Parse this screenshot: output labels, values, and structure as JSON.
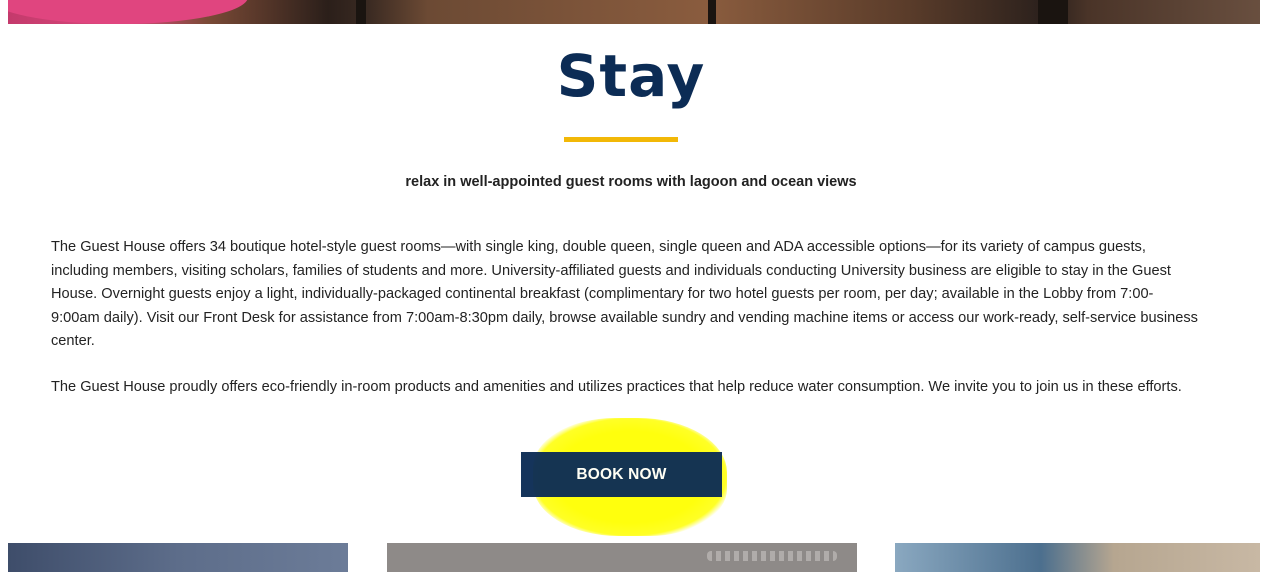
{
  "section": {
    "title": "Stay",
    "subtitle": "relax in well-appointed guest rooms with lagoon and ocean views",
    "paragraphs": [
      "The Guest House offers 34 boutique hotel-style guest rooms—with single king, double queen, single queen and ADA accessible options—for its variety of campus guests, including members, visiting scholars, families of students and more. University-affiliated guests and individuals conducting University business are eligible to stay in the Guest House. Overnight guests enjoy a light, individually-packaged continental breakfast (complimentary for two hotel guests per room, per day; available in the Lobby from 7:00-9:00am daily). Visit our Front Desk for assistance from 7:00am-8:30pm daily, browse available sundry and vending machine items or access our work-ready, self-service business center.",
      "The Guest House proudly offers eco-friendly in-room products and amenities and utilizes practices that help reduce water consumption. We invite you to join us in these efforts."
    ],
    "cta_label": "BOOK NOW"
  },
  "colors": {
    "title": "#0c2c55",
    "accent_underline": "#f2b807",
    "button_bg": "#0c2c55",
    "highlight_mark": "#ffff00"
  }
}
